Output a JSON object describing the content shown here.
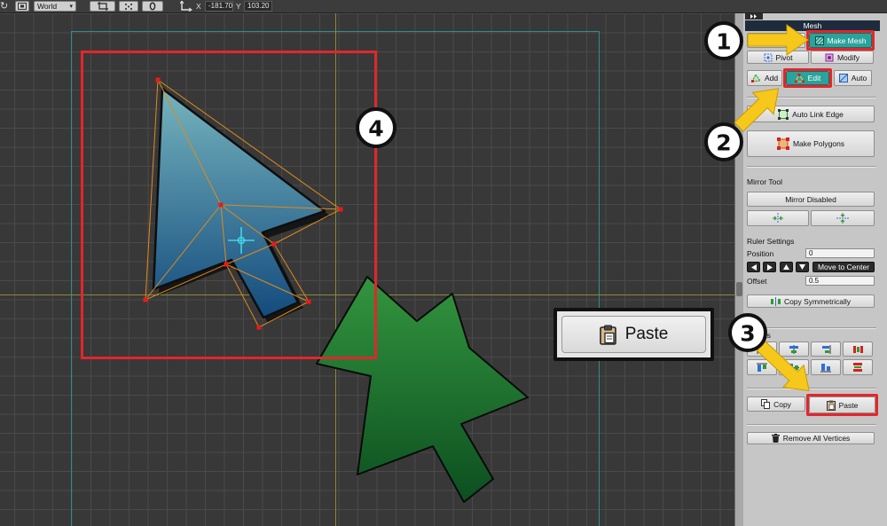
{
  "toolbar": {
    "space": "World",
    "x_label": "X",
    "x_value": "-181.70",
    "y_label": "Y",
    "y_value": "103.20"
  },
  "panel": {
    "header": "Mesh",
    "tabs": {
      "make_mesh": "Make Mesh",
      "pivot": "Pivot",
      "modify": "Modify"
    },
    "edit_modes": {
      "add": "Add",
      "edit": "Edit",
      "auto": "Auto"
    },
    "auto_link_edge": "Auto Link Edge",
    "make_polygons": "Make Polygons",
    "mirror": {
      "title": "Mirror Tool",
      "status_button": "Mirror Disabled"
    },
    "ruler": {
      "title": "Ruler Settings",
      "position_label": "Position",
      "position_value": "0",
      "move_to_center": "Move to Center",
      "offset_label": "Offset",
      "offset_value": "0.5"
    },
    "copy_symmetrically": "Copy Symmetrically",
    "tools_label_partial": "ols",
    "copy": "Copy",
    "paste": "Paste",
    "remove_all_vertices": "Remove All Vertices"
  },
  "callouts": {
    "step1": "1",
    "step2": "2",
    "step3": "3",
    "step4": "4",
    "paste_zoom_label": "Paste"
  },
  "colors": {
    "accent_teal": "#2aa39a",
    "highlight_red": "#e3262b",
    "callout_yellow": "#f6c81b",
    "mesh_edge": "#e08a1c",
    "mesh_vertex": "#e81a1a",
    "pivot_cross": "#3fd5e8"
  },
  "icons": {
    "toolbar": [
      "refresh-icon",
      "frame-icon",
      "chevron-down-icon",
      "crop-icon",
      "grid-dots-icon",
      "onion-skin-icon",
      "axis-icon"
    ],
    "panel": [
      "collapse-panel-icon",
      "make-mesh-icon",
      "pivot-icon",
      "modify-icon",
      "add-vertex-icon",
      "edit-mesh-icon",
      "auto-mesh-icon",
      "auto-link-edge-icon",
      "make-polygons-icon",
      "mirror-x-icon",
      "mirror-y-icon",
      "arrow-left-icon",
      "arrow-right-icon",
      "arrow-up-icon",
      "arrow-down-icon",
      "align-icon",
      "copy-icon",
      "paste-icon",
      "trash-icon"
    ]
  }
}
